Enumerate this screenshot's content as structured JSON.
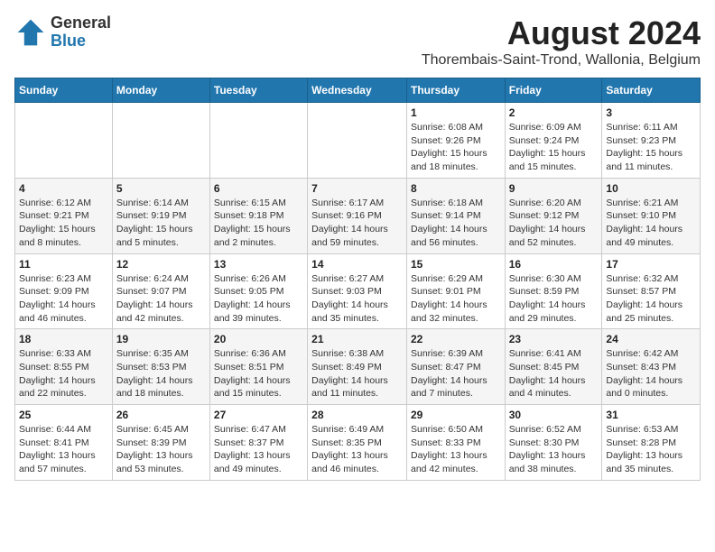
{
  "header": {
    "logo_line1": "General",
    "logo_line2": "Blue",
    "title": "August 2024",
    "subtitle": "Thorembais-Saint-Trond, Wallonia, Belgium"
  },
  "calendar": {
    "weekdays": [
      "Sunday",
      "Monday",
      "Tuesday",
      "Wednesday",
      "Thursday",
      "Friday",
      "Saturday"
    ],
    "weeks": [
      [
        {
          "day": "",
          "info": ""
        },
        {
          "day": "",
          "info": ""
        },
        {
          "day": "",
          "info": ""
        },
        {
          "day": "",
          "info": ""
        },
        {
          "day": "1",
          "info": "Sunrise: 6:08 AM\nSunset: 9:26 PM\nDaylight: 15 hours\nand 18 minutes."
        },
        {
          "day": "2",
          "info": "Sunrise: 6:09 AM\nSunset: 9:24 PM\nDaylight: 15 hours\nand 15 minutes."
        },
        {
          "day": "3",
          "info": "Sunrise: 6:11 AM\nSunset: 9:23 PM\nDaylight: 15 hours\nand 11 minutes."
        }
      ],
      [
        {
          "day": "4",
          "info": "Sunrise: 6:12 AM\nSunset: 9:21 PM\nDaylight: 15 hours\nand 8 minutes."
        },
        {
          "day": "5",
          "info": "Sunrise: 6:14 AM\nSunset: 9:19 PM\nDaylight: 15 hours\nand 5 minutes."
        },
        {
          "day": "6",
          "info": "Sunrise: 6:15 AM\nSunset: 9:18 PM\nDaylight: 15 hours\nand 2 minutes."
        },
        {
          "day": "7",
          "info": "Sunrise: 6:17 AM\nSunset: 9:16 PM\nDaylight: 14 hours\nand 59 minutes."
        },
        {
          "day": "8",
          "info": "Sunrise: 6:18 AM\nSunset: 9:14 PM\nDaylight: 14 hours\nand 56 minutes."
        },
        {
          "day": "9",
          "info": "Sunrise: 6:20 AM\nSunset: 9:12 PM\nDaylight: 14 hours\nand 52 minutes."
        },
        {
          "day": "10",
          "info": "Sunrise: 6:21 AM\nSunset: 9:10 PM\nDaylight: 14 hours\nand 49 minutes."
        }
      ],
      [
        {
          "day": "11",
          "info": "Sunrise: 6:23 AM\nSunset: 9:09 PM\nDaylight: 14 hours\nand 46 minutes."
        },
        {
          "day": "12",
          "info": "Sunrise: 6:24 AM\nSunset: 9:07 PM\nDaylight: 14 hours\nand 42 minutes."
        },
        {
          "day": "13",
          "info": "Sunrise: 6:26 AM\nSunset: 9:05 PM\nDaylight: 14 hours\nand 39 minutes."
        },
        {
          "day": "14",
          "info": "Sunrise: 6:27 AM\nSunset: 9:03 PM\nDaylight: 14 hours\nand 35 minutes."
        },
        {
          "day": "15",
          "info": "Sunrise: 6:29 AM\nSunset: 9:01 PM\nDaylight: 14 hours\nand 32 minutes."
        },
        {
          "day": "16",
          "info": "Sunrise: 6:30 AM\nSunset: 8:59 PM\nDaylight: 14 hours\nand 29 minutes."
        },
        {
          "day": "17",
          "info": "Sunrise: 6:32 AM\nSunset: 8:57 PM\nDaylight: 14 hours\nand 25 minutes."
        }
      ],
      [
        {
          "day": "18",
          "info": "Sunrise: 6:33 AM\nSunset: 8:55 PM\nDaylight: 14 hours\nand 22 minutes."
        },
        {
          "day": "19",
          "info": "Sunrise: 6:35 AM\nSunset: 8:53 PM\nDaylight: 14 hours\nand 18 minutes."
        },
        {
          "day": "20",
          "info": "Sunrise: 6:36 AM\nSunset: 8:51 PM\nDaylight: 14 hours\nand 15 minutes."
        },
        {
          "day": "21",
          "info": "Sunrise: 6:38 AM\nSunset: 8:49 PM\nDaylight: 14 hours\nand 11 minutes."
        },
        {
          "day": "22",
          "info": "Sunrise: 6:39 AM\nSunset: 8:47 PM\nDaylight: 14 hours\nand 7 minutes."
        },
        {
          "day": "23",
          "info": "Sunrise: 6:41 AM\nSunset: 8:45 PM\nDaylight: 14 hours\nand 4 minutes."
        },
        {
          "day": "24",
          "info": "Sunrise: 6:42 AM\nSunset: 8:43 PM\nDaylight: 14 hours\nand 0 minutes."
        }
      ],
      [
        {
          "day": "25",
          "info": "Sunrise: 6:44 AM\nSunset: 8:41 PM\nDaylight: 13 hours\nand 57 minutes."
        },
        {
          "day": "26",
          "info": "Sunrise: 6:45 AM\nSunset: 8:39 PM\nDaylight: 13 hours\nand 53 minutes."
        },
        {
          "day": "27",
          "info": "Sunrise: 6:47 AM\nSunset: 8:37 PM\nDaylight: 13 hours\nand 49 minutes."
        },
        {
          "day": "28",
          "info": "Sunrise: 6:49 AM\nSunset: 8:35 PM\nDaylight: 13 hours\nand 46 minutes."
        },
        {
          "day": "29",
          "info": "Sunrise: 6:50 AM\nSunset: 8:33 PM\nDaylight: 13 hours\nand 42 minutes."
        },
        {
          "day": "30",
          "info": "Sunrise: 6:52 AM\nSunset: 8:30 PM\nDaylight: 13 hours\nand 38 minutes."
        },
        {
          "day": "31",
          "info": "Sunrise: 6:53 AM\nSunset: 8:28 PM\nDaylight: 13 hours\nand 35 minutes."
        }
      ]
    ]
  }
}
